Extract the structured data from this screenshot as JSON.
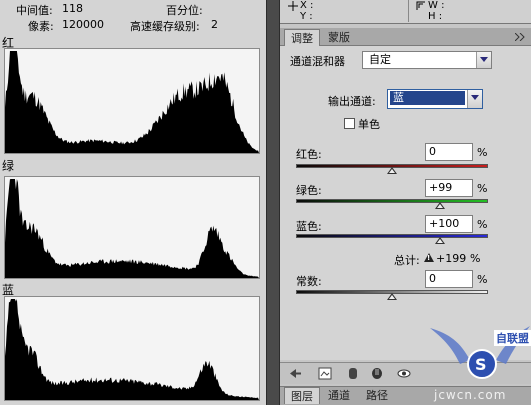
{
  "histogram": {
    "stats": {
      "median_label": "中间值:",
      "median_value": "118",
      "percentile_label": "百分位:",
      "pixels_label": "像素:",
      "pixels_value": "120000",
      "cache_label": "高速缓存级别:",
      "cache_value": "2"
    },
    "channels": [
      {
        "label": "红"
      },
      {
        "label": "绿"
      },
      {
        "label": "蓝"
      }
    ]
  },
  "info": {
    "xy_label_x": "X :",
    "xy_label_y": "Y :",
    "wh_label_w": "W :",
    "wh_label_h": "H :"
  },
  "tabs": {
    "adjustments": "调整",
    "masks": "蒙版"
  },
  "channel_mixer": {
    "title": "通道混和器",
    "preset_value": "自定",
    "output_label": "输出通道:",
    "output_value": "蓝",
    "monochrome_label": "单色",
    "red_label": "红色:",
    "red_value": "0",
    "green_label": "绿色:",
    "green_value": "+99",
    "blue_label": "蓝色:",
    "blue_value": "+100",
    "total_label": "总计:",
    "total_value": "+199",
    "constant_label": "常数:",
    "constant_value": "0",
    "pct": "%",
    "levels": {
      "red": 0,
      "green": 99,
      "blue": 100,
      "constant": 0
    }
  },
  "bottom_tabs": {
    "layers": "图层",
    "channels": "通道",
    "paths": "路径"
  },
  "watermark": {
    "site": "jcwcn.com",
    "badge": "自联盟"
  },
  "colors": {
    "panel": "#d4d4d4",
    "highlight": "#24458c",
    "red_slider_end": "#c81e1e",
    "green_slider_end": "#25c025",
    "blue_slider_end": "#2a2ad8"
  }
}
